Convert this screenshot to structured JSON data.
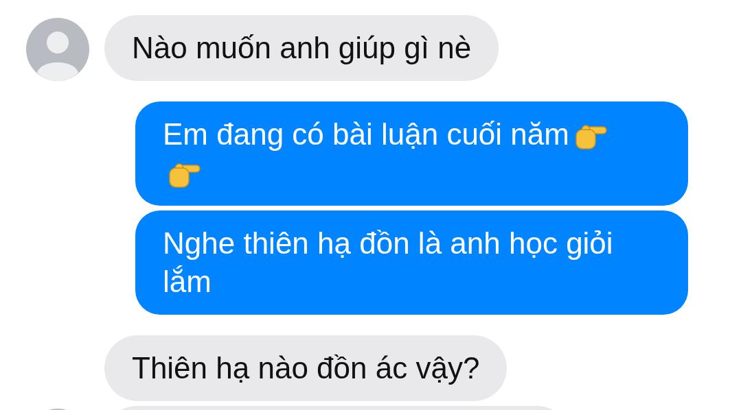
{
  "messages": [
    {
      "kind": "incoming",
      "avatar": true,
      "text": "Nào muốn anh giúp gì nè"
    },
    {
      "kind": "outgoing",
      "text": "Em đang có bài luận cuối năm",
      "emojis": [
        {
          "kind": "pointing-right"
        },
        {
          "kind": "pointing-right"
        }
      ]
    },
    {
      "kind": "outgoing",
      "text": "Nghe thiên hạ đồn là anh học giỏi lắm"
    },
    {
      "kind": "incoming",
      "avatar": false,
      "text": "Thiên hạ nào đồn ác vậy?"
    },
    {
      "kind": "incoming",
      "avatar": true
    }
  ]
}
